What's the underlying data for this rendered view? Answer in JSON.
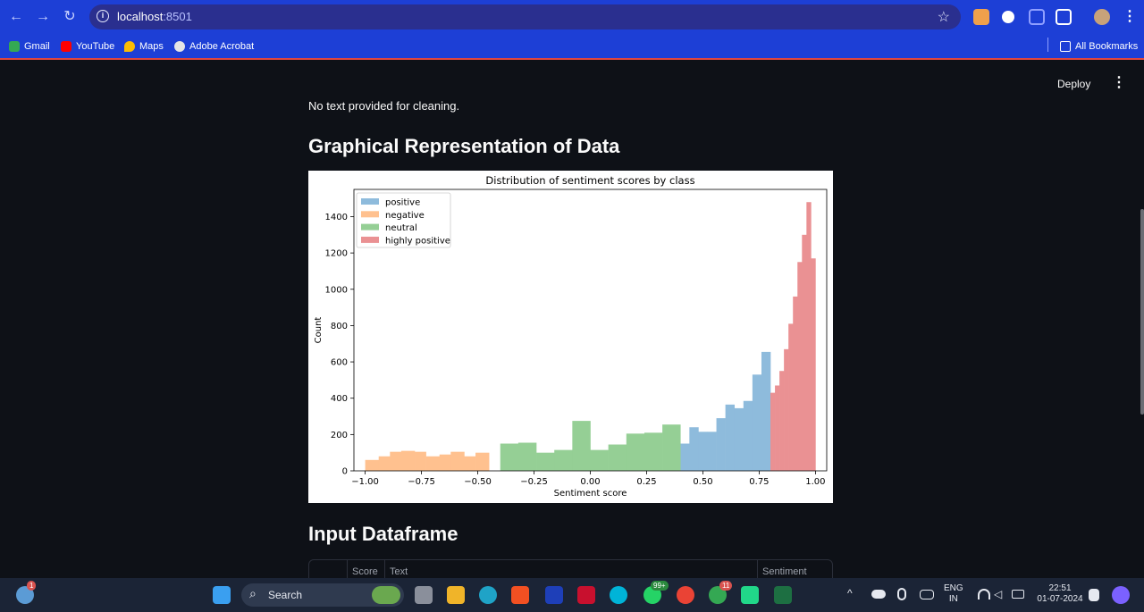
{
  "browser": {
    "url_host": "localhost",
    "url_port": ":8501",
    "bookmarks": [
      {
        "label": "Gmail",
        "color": "#34a853"
      },
      {
        "label": "YouTube",
        "color": "#ff0000"
      },
      {
        "label": "Maps",
        "color": "#fbbc04"
      },
      {
        "label": "Adobe Acrobat",
        "color": "#e5e5e5"
      }
    ],
    "all_bookmarks": "All Bookmarks"
  },
  "app": {
    "deploy_label": "Deploy",
    "cleaning_text": "No text provided for cleaning.",
    "graph_heading": "Graphical Representation of Data",
    "df_heading": "Input Dataframe",
    "df_columns": [
      "Score",
      "Text",
      "Sentiment Score"
    ]
  },
  "chart_data": {
    "type": "bar",
    "title": "Distribution of sentiment scores by class",
    "xlabel": "Sentiment score",
    "ylabel": "Count",
    "xlim": [
      -1.05,
      1.05
    ],
    "ylim": [
      0,
      1550
    ],
    "xticks": [
      -1.0,
      -0.75,
      -0.5,
      -0.25,
      0.0,
      0.25,
      0.5,
      0.75,
      1.0
    ],
    "xtick_labels": [
      "−1.00",
      "−0.75",
      "−0.50",
      "−0.25",
      "0.00",
      "0.25",
      "0.50",
      "0.75",
      "1.00"
    ],
    "yticks": [
      0,
      200,
      400,
      600,
      800,
      1000,
      1200,
      1400
    ],
    "legend_position": "upper-left",
    "series": [
      {
        "name": "positive",
        "color": "#8ebbdc",
        "bins": [
          [
            0.4,
            0.44,
            150
          ],
          [
            0.44,
            0.48,
            240
          ],
          [
            0.48,
            0.52,
            215
          ],
          [
            0.52,
            0.56,
            215
          ],
          [
            0.56,
            0.6,
            290
          ],
          [
            0.6,
            0.64,
            365
          ],
          [
            0.64,
            0.68,
            345
          ],
          [
            0.68,
            0.72,
            385
          ],
          [
            0.72,
            0.76,
            530
          ],
          [
            0.76,
            0.8,
            655
          ]
        ]
      },
      {
        "name": "negative",
        "color": "#ffc18f",
        "bins": [
          [
            -1.0,
            -0.94,
            60
          ],
          [
            -0.94,
            -0.89,
            80
          ],
          [
            -0.89,
            -0.84,
            105
          ],
          [
            -0.84,
            -0.78,
            110
          ],
          [
            -0.78,
            -0.73,
            105
          ],
          [
            -0.73,
            -0.67,
            80
          ],
          [
            -0.67,
            -0.62,
            90
          ],
          [
            -0.62,
            -0.56,
            105
          ],
          [
            -0.56,
            -0.51,
            80
          ],
          [
            -0.51,
            -0.45,
            100
          ]
        ]
      },
      {
        "name": "neutral",
        "color": "#95cf95",
        "bins": [
          [
            -0.4,
            -0.32,
            150
          ],
          [
            -0.32,
            -0.24,
            155
          ],
          [
            -0.24,
            -0.16,
            100
          ],
          [
            -0.16,
            -0.08,
            115
          ],
          [
            -0.08,
            0.0,
            275
          ],
          [
            0.0,
            0.08,
            115
          ],
          [
            0.08,
            0.16,
            145
          ],
          [
            0.16,
            0.24,
            205
          ],
          [
            0.24,
            0.32,
            210
          ],
          [
            0.32,
            0.4,
            255
          ]
        ]
      },
      {
        "name": "highly positive",
        "color": "#ea9193",
        "bins": [
          [
            0.8,
            0.82,
            430
          ],
          [
            0.82,
            0.84,
            470
          ],
          [
            0.84,
            0.86,
            550
          ],
          [
            0.86,
            0.88,
            670
          ],
          [
            0.88,
            0.9,
            810
          ],
          [
            0.9,
            0.92,
            960
          ],
          [
            0.92,
            0.94,
            1150
          ],
          [
            0.94,
            0.96,
            1300
          ],
          [
            0.96,
            0.98,
            1480
          ],
          [
            0.98,
            1.0,
            1170
          ]
        ]
      }
    ]
  },
  "taskbar": {
    "search_label": "Search",
    "lang_line1": "ENG",
    "lang_line2": "IN",
    "time": "22:51",
    "date": "01-07-2024",
    "whatsapp_badge": "99+",
    "chrome_badge": "11",
    "weather_badge": "1"
  }
}
